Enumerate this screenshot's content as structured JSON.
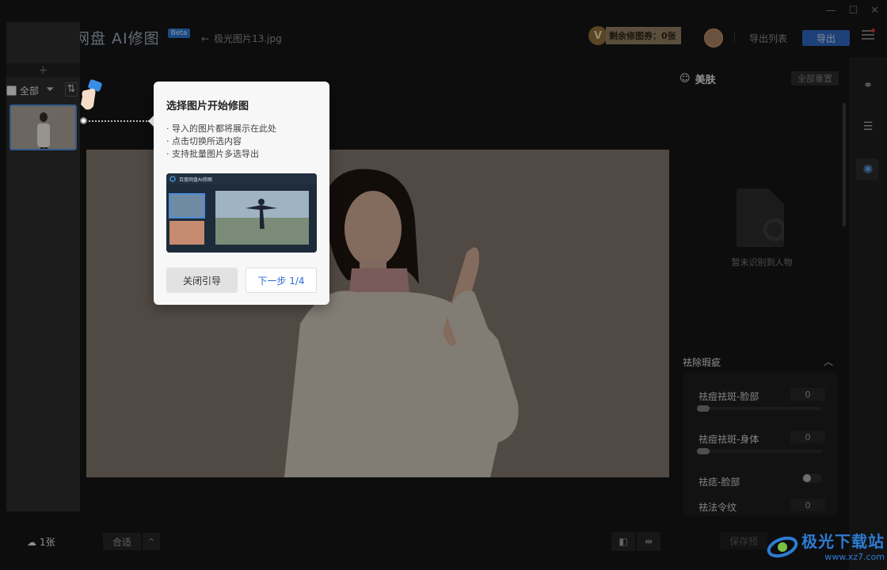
{
  "app": {
    "name": "百度网盘 AI修图",
    "badge": "Beta",
    "file_name": "极光图片13.jpg"
  },
  "window_controls": [
    "—",
    "☐",
    "✕"
  ],
  "header": {
    "coupon_letter": "V",
    "coupon_text": "剩余修图券：0张",
    "export_list_label": "导出列表",
    "export_label": "导出"
  },
  "left": {
    "add_label": "+",
    "select_all_label": "全部",
    "count_label": "1张"
  },
  "canvas": {
    "fit_label": "合适",
    "fit_arrow": "^",
    "compare_icons": [
      "◧",
      "⇹"
    ]
  },
  "guide": {
    "title": "选择图片开始修图",
    "lines": [
      "· 导入的图片都将展示在此处",
      "· 点击切换所选内容",
      "· 支持批量图片多选导出"
    ],
    "preview_title": "百度网盘AI修图",
    "close_label": "关闭引导",
    "next_label": "下一步 1/4"
  },
  "right": {
    "section_title": "美肤",
    "reset_label": "全部重置",
    "no_face_text": "暂未识别到人物",
    "group_title": "祛除瑕疵",
    "adjustments": [
      {
        "label": "祛痘祛斑-脸部",
        "value": "0",
        "type": "slider"
      },
      {
        "label": "祛痘祛斑-身体",
        "value": "0",
        "type": "slider"
      },
      {
        "label": "祛痣-脸部",
        "value": "",
        "type": "toggle"
      },
      {
        "label": "祛法令纹",
        "value": "0",
        "type": "slider"
      }
    ],
    "save_label": "保存预"
  },
  "watermark": {
    "title": "极光下载站",
    "url": "www.xz7.com"
  },
  "colors": {
    "accent": "#2e63b8",
    "bg": "#141414",
    "popover": "#f7f7f7"
  }
}
